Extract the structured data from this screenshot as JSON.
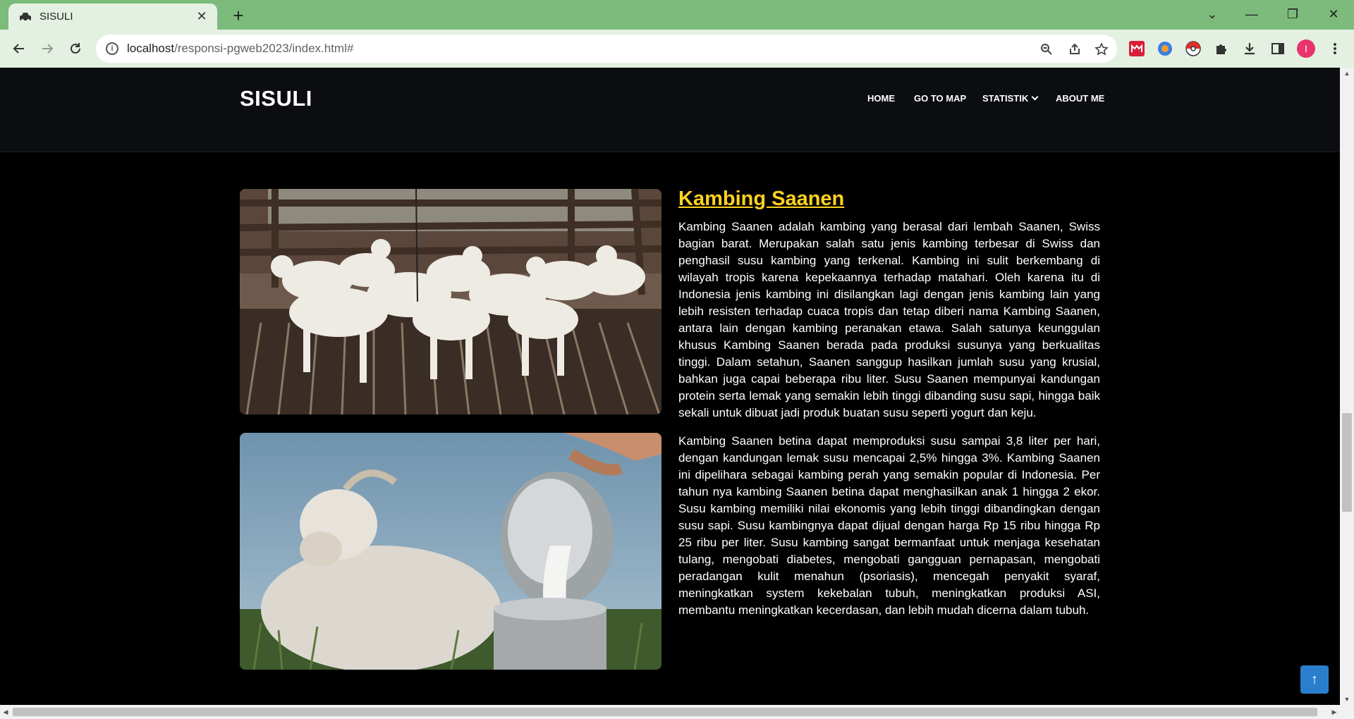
{
  "browser": {
    "tab_title": "SISULI",
    "new_tab": "+",
    "url_host": "localhost",
    "url_path": "/responsi-pgweb2023/index.html#",
    "tab_close": "✕",
    "minimize": "—",
    "restore": "❐",
    "close": "✕",
    "tabs_menu": "⌄",
    "profile_initial": "I"
  },
  "site": {
    "logo": "SISULI",
    "nav": [
      {
        "label": "HOME"
      },
      {
        "label": "GO TO MAP"
      },
      {
        "label": "STATISTIK"
      },
      {
        "label": "ABOUT ME"
      }
    ]
  },
  "article": {
    "title": "Kambing Saanen",
    "paragraph1": "Kambing Saanen adalah kambing yang berasal dari lembah Saanen, Swiss bagian barat. Merupakan salah satu jenis kambing terbesar di Swiss dan penghasil susu kambing yang terkenal. Kambing ini sulit berkembang di wilayah tropis karena kepekaannya terhadap matahari. Oleh karena itu di Indonesia jenis kambing ini disilangkan lagi dengan jenis kambing lain yang lebih resisten terhadap cuaca tropis dan tetap diberi nama Kambing Saanen, antara lain dengan kambing peranakan etawa. Salah satunya keunggulan khusus Kambing Saanen berada pada produksi susunya yang berkualitas tinggi. Dalam setahun, Saanen sanggup hasilkan jumlah susu yang krusial, bahkan juga capai beberapa ribu liter. Susu Saanen mempunyai kandungan protein serta lemak yang semakin lebih tinggi dibanding susu sapi, hingga baik sekali untuk dibuat jadi produk buatan susu seperti yogurt dan keju.",
    "paragraph2": "Kambing Saanen betina dapat memproduksi susu sampai 3,8 liter per hari, dengan kandungan lemak susu mencapai 2,5% hingga 3%. Kambing Saanen ini dipelihara sebagai kambing perah yang semakin popular di Indonesia. Per tahun nya kambing Saanen betina dapat menghasilkan anak 1 hingga 2 ekor. Susu kambing memiliki nilai ekonomis yang lebih tinggi dibandingkan dengan susu sapi. Susu kambingnya dapat dijual dengan harga Rp 15 ribu hingga Rp 25 ribu per liter. Susu kambing sangat bermanfaat untuk menjaga kesehatan tulang, mengobati diabetes, mengobati gangguan pernapasan, mengobati peradangan kulit menahun (psoriasis), mencegah penyakit syaraf, meningkatkan system kekebalan tubuh, meningkatkan produksi ASI, membantu meningkatkan kecerdasan, dan lebih mudah dicerna dalam tubuh."
  },
  "colors": {
    "tabbar": "#7dbb7c",
    "toolbar": "#e4f1e2",
    "title_accent": "#ffd21f",
    "to_top_button": "#2a7fcc"
  },
  "back_to_top": "↑"
}
